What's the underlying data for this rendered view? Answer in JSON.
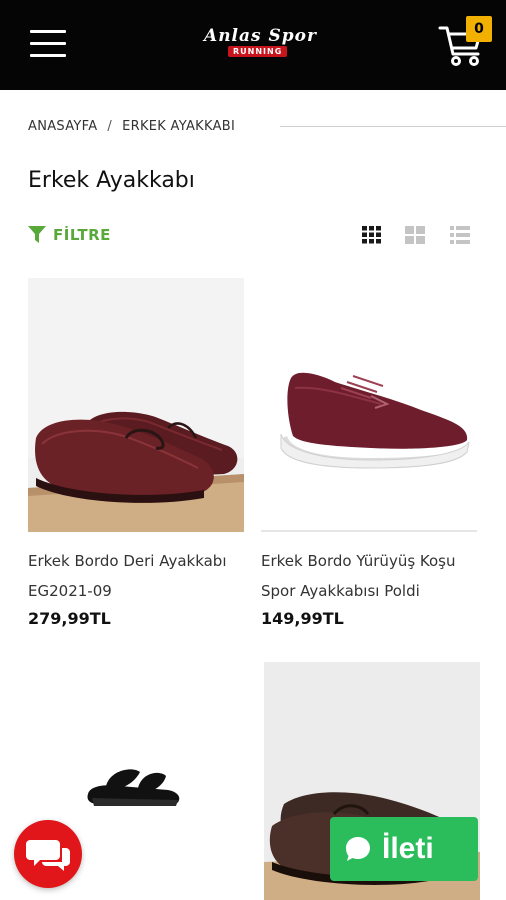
{
  "header": {
    "menu_icon": "hamburger-menu-icon",
    "logo_text_top": "Anlas Spor",
    "logo_text_bottom": "RUNNING",
    "cart_icon": "shopping-cart-icon",
    "cart_count": "0"
  },
  "breadcrumb": {
    "items": [
      "ANASAYFA",
      "ERKEK AYAKKABI"
    ],
    "separator": "/"
  },
  "page_title": "Erkek Ayakkabı",
  "toolbar": {
    "filter_label": "FİLTRE",
    "filter_icon": "funnel-icon",
    "view_modes": [
      "grid-3-icon",
      "grid-2-icon",
      "list-icon"
    ],
    "active_view": "grid-3-icon"
  },
  "products": [
    {
      "name_line1": "Erkek Bordo Deri Ayakkabı",
      "name_line2": "EG2021-09",
      "price": "279,99TL",
      "image": "burgundy-leather-loafer"
    },
    {
      "name_line1": "Erkek Bordo Yürüyüş Koşu",
      "name_line2": "Spor Ayakkabısı Poldi",
      "price": "149,99TL",
      "image": "burgundy-running-sneaker"
    },
    {
      "name_line1": "",
      "name_line2": "",
      "price": "",
      "image": "black-slide-sandal"
    },
    {
      "name_line1": "",
      "name_line2": "",
      "price": "",
      "image": "brown-leather-loafer"
    }
  ],
  "floating": {
    "chat_icon": "chat-bubbles-icon",
    "ileti_label": "İleti",
    "ileti_icon": "message-bubble-icon"
  },
  "colors": {
    "header_bg": "#050505",
    "accent_green": "#58a83a",
    "badge_yellow": "#f2b100",
    "chat_red": "#e0161b",
    "message_green": "#2bbd5c"
  }
}
